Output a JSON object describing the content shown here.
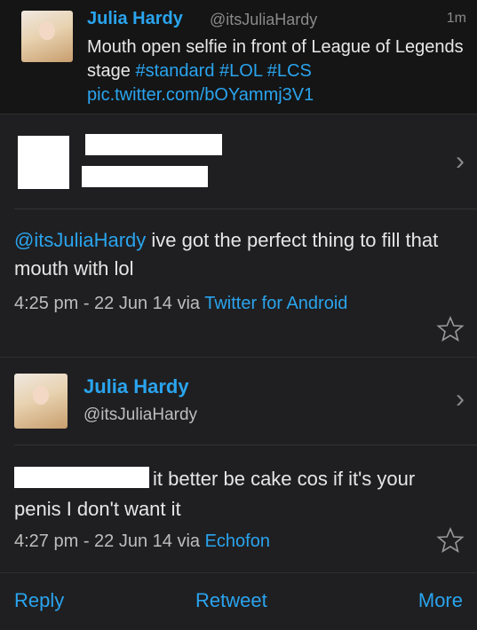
{
  "top_tweet": {
    "name": "Julia Hardy",
    "handle": "@itsJuliaHardy",
    "time": "1m",
    "text_plain": "Mouth open selfie in front of League of Legends stage ",
    "tags": [
      "#standard",
      "#LOL",
      "#LCS"
    ],
    "link": "pic.twitter.com/bOYammj3V1"
  },
  "main_tweet": {
    "mention": "@itsJuliaHardy",
    "text": " ive got the perfect thing to fill that mouth with lol",
    "timestamp": "4:25 pm - 22 Jun 14 via ",
    "via": "Twitter for Android"
  },
  "reply_tweet": {
    "name": "Julia Hardy",
    "handle": "@itsJuliaHardy",
    "text": "it better be cake cos if it's your penis I don't want it",
    "timestamp": "4:27 pm - 22 Jun 14 via ",
    "via": "Echofon"
  },
  "actions": {
    "reply": "Reply",
    "retweet": "Retweet",
    "more": "More"
  },
  "colors": {
    "link": "#2aa4ee",
    "background": "#1f1f21"
  },
  "icons": [
    "chevron-right-icon",
    "star-icon"
  ]
}
